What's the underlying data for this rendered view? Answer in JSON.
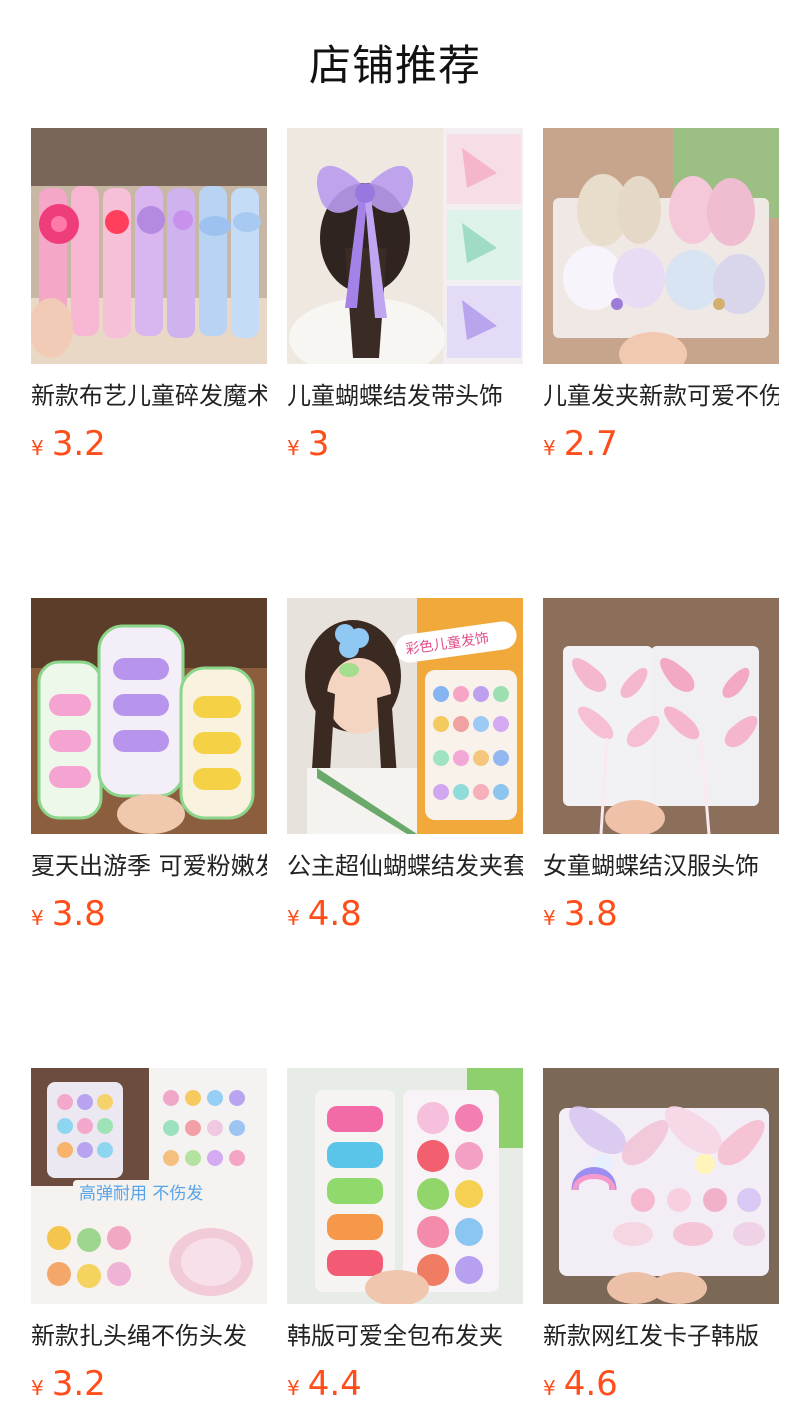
{
  "page": {
    "title": "店铺推荐"
  },
  "colors": {
    "price": "#ff4e1a",
    "text": "#222222",
    "background": "#ffffff"
  },
  "products": [
    {
      "name": "新款布艺儿童碎发魔术贴",
      "currency": "¥",
      "price": "3.2",
      "image": "pink floral velcro hair sticker cards held in hand"
    },
    {
      "name": "儿童蝴蝶结发带头饰",
      "currency": "¥",
      "price": "3",
      "image": "girl wearing purple organza bow with braided hair"
    },
    {
      "name": "儿童发夹新款可爱不伤发",
      "currency": "¥",
      "price": "2.7",
      "image": "sequin bunny-ear hair clips on card"
    },
    {
      "name": "夏天出游季 可爱粉嫩发夹",
      "currency": "¥",
      "price": "3.8",
      "image": "pastel cartoon snap hair clips on cards"
    },
    {
      "name": "公主超仙蝴蝶结发夹套装",
      "currency": "¥",
      "price": "4.8",
      "image": "girl with colorful children hair clips",
      "badge": "彩色儿童发饰"
    },
    {
      "name": "女童蝴蝶结汉服头饰",
      "currency": "¥",
      "price": "3.8",
      "image": "pink lace butterfly bows with ribbons"
    },
    {
      "name": "新款扎头绳不伤头发",
      "currency": "¥",
      "price": "3.2",
      "image": "collage of elastic hair ties and mini hair bands",
      "badge": "高弹耐用 不伤发"
    },
    {
      "name": "韩版可爱全包布发夹",
      "currency": "¥",
      "price": "4.4",
      "image": "fruit shaped hair clips on card"
    },
    {
      "name": "新款网红发卡子韩版",
      "currency": "¥",
      "price": "4.6",
      "image": "pink sparkly bow and unicorn hair clips"
    }
  ]
}
